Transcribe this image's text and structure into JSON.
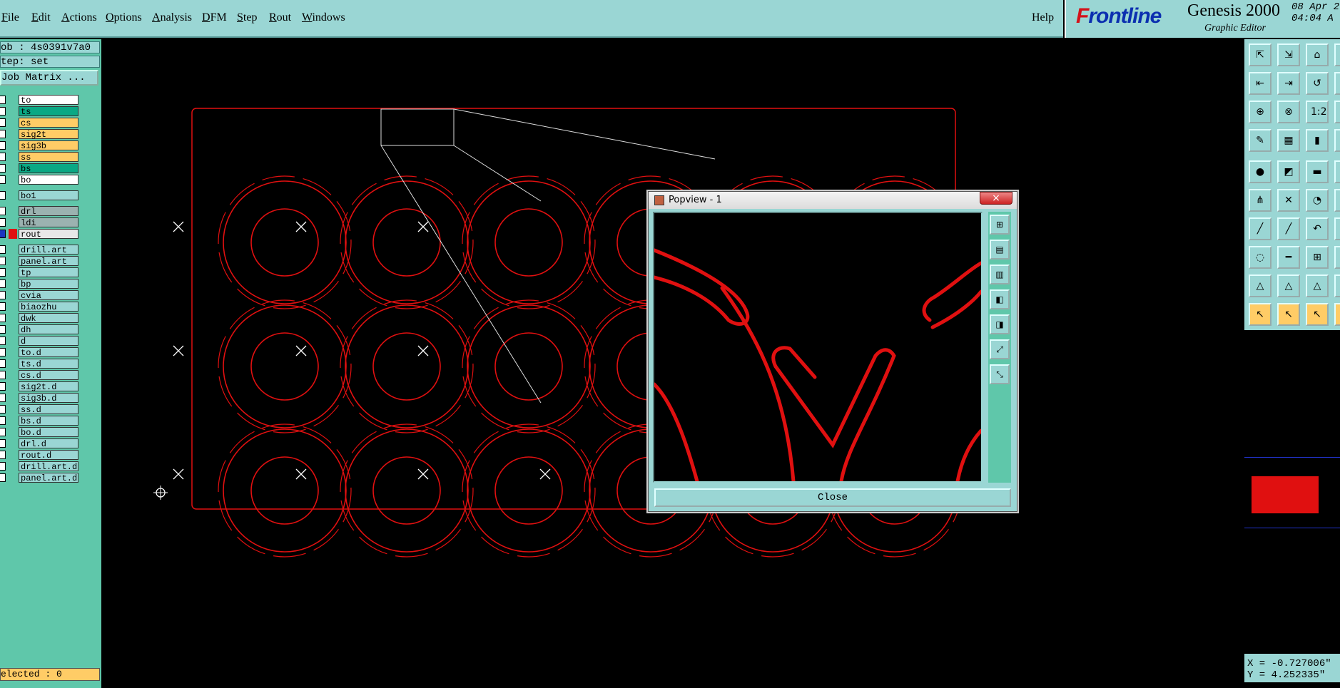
{
  "menu": {
    "items": [
      {
        "label": "File",
        "key": "F",
        "rest": "ile"
      },
      {
        "label": "Edit",
        "key": "E",
        "rest": "dit"
      },
      {
        "label": "Actions",
        "key": "A",
        "rest": "ctions"
      },
      {
        "label": "Options",
        "key": "O",
        "rest": "ptions"
      },
      {
        "label": "Analysis",
        "key": "A",
        "rest": "nalysis"
      },
      {
        "label": "DFM",
        "key": "D",
        "rest": "FM"
      },
      {
        "label": "Step",
        "key": "S",
        "rest": "tep"
      },
      {
        "label": "Rout",
        "key": "R",
        "rest": "out"
      },
      {
        "label": "Windows",
        "key": "W",
        "rest": "indows"
      }
    ],
    "help": "Help"
  },
  "logo": {
    "brand_red": "F",
    "brand_rest": "rontline",
    "product": "Genesis 2000",
    "subtitle": "Graphic Editor",
    "date": "08 Apr 2",
    "time": "04:04 A"
  },
  "left": {
    "job": "ob : 4s0391v7a0",
    "step": "tep: set",
    "job_matrix": "Job Matrix ...",
    "layers": [
      {
        "name": "to",
        "color": "#ffffff"
      },
      {
        "name": "ts",
        "color": "#0aa884"
      },
      {
        "name": "cs",
        "color": "#ffcc66"
      },
      {
        "name": "sig2t",
        "color": "#ffcc66"
      },
      {
        "name": "sig3b",
        "color": "#ffcc66"
      },
      {
        "name": "ss",
        "color": "#ffcc66"
      },
      {
        "name": "bs",
        "color": "#0aa884"
      },
      {
        "name": "bo",
        "color": "#ffffff"
      },
      {
        "name": "bo1",
        "color": "#9ad6d4"
      },
      {
        "name": "drl",
        "color": "#9bb2b0"
      },
      {
        "name": "ldi",
        "color": "#9bb2b0"
      },
      {
        "name": "rout",
        "color": "#e8e8e8"
      },
      {
        "name": "drill.art",
        "color": "#9ad6d4"
      },
      {
        "name": "panel.art",
        "color": "#9ad6d4"
      },
      {
        "name": "tp",
        "color": "#9ad6d4"
      },
      {
        "name": "bp",
        "color": "#9ad6d4"
      },
      {
        "name": "cvia",
        "color": "#9ad6d4"
      },
      {
        "name": "biaozhu",
        "color": "#9ad6d4"
      },
      {
        "name": "dwk",
        "color": "#9ad6d4"
      },
      {
        "name": "dh",
        "color": "#9ad6d4"
      },
      {
        "name": "d",
        "color": "#9ad6d4"
      },
      {
        "name": "to.d",
        "color": "#9ad6d4"
      },
      {
        "name": "ts.d",
        "color": "#9ad6d4"
      },
      {
        "name": "cs.d",
        "color": "#9ad6d4"
      },
      {
        "name": "sig2t.d",
        "color": "#9ad6d4"
      },
      {
        "name": "sig3b.d",
        "color": "#9ad6d4"
      },
      {
        "name": "ss.d",
        "color": "#9ad6d4"
      },
      {
        "name": "bs.d",
        "color": "#9ad6d4"
      },
      {
        "name": "bo.d",
        "color": "#9ad6d4"
      },
      {
        "name": "drl.d",
        "color": "#9ad6d4"
      },
      {
        "name": "rout.d",
        "color": "#9ad6d4"
      },
      {
        "name": "drill.art.d",
        "color": "#9ad6d4"
      },
      {
        "name": "panel.art.d",
        "color": "#9ad6d4"
      }
    ],
    "selected": "elected : 0"
  },
  "popup": {
    "title": "Popview - 1",
    "close_x": "×",
    "close_label": "Close"
  },
  "right": {
    "coord_x": "X = -0.727006\"",
    "coord_y": "Y = 4.252335\"",
    "tools": [
      "⇱",
      "⇲",
      "⌂",
      "□",
      "⇤",
      "⇥",
      "↺",
      "⇧",
      "⊕",
      "⊗",
      "1:2",
      "▥",
      "✎",
      "▦",
      "▮",
      "▣",
      "●",
      "◩",
      "▬",
      "▢",
      "⋔",
      "✕",
      "◔",
      "▨",
      "╱",
      "╱",
      "↶",
      "▤",
      "◌",
      "━",
      "⊞",
      "▧",
      "△",
      "△",
      "△",
      "▩",
      "↖",
      "↖",
      "↖",
      "▪"
    ],
    "ptools": [
      "⊞",
      "▤",
      "▥",
      "◧",
      "◨",
      "⤢",
      "⤡"
    ]
  },
  "colors": {
    "accent": "#9ad6d4",
    "trace": "#e01010",
    "panel": "#5fc7aa"
  }
}
